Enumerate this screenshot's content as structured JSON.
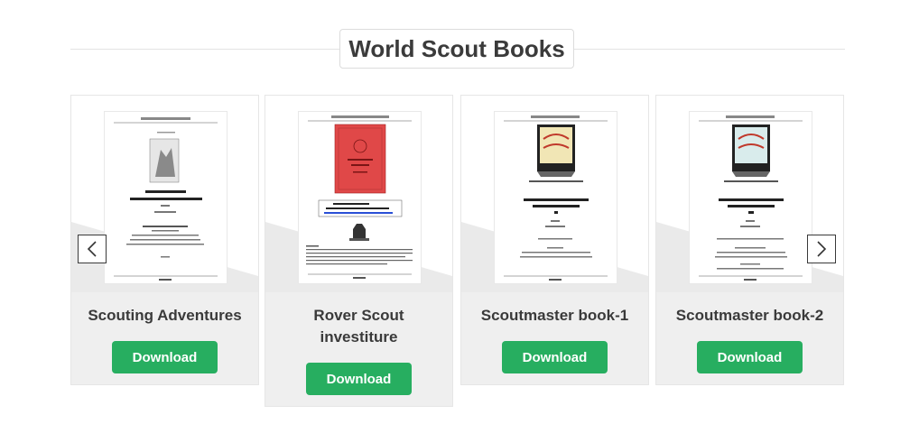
{
  "section": {
    "title": "World Scout Books"
  },
  "carousel": {
    "prev_icon": "chevron-left-icon",
    "next_icon": "chevron-right-icon",
    "accent": "#27ae60",
    "cards": [
      {
        "title": "Scouting Adventures",
        "button": "Download"
      },
      {
        "title": "Rover Scout investiture",
        "button": "Download"
      },
      {
        "title": "Scoutmaster book-1",
        "button": "Download"
      },
      {
        "title": "Scoutmaster book-2",
        "button": "Download"
      }
    ]
  }
}
